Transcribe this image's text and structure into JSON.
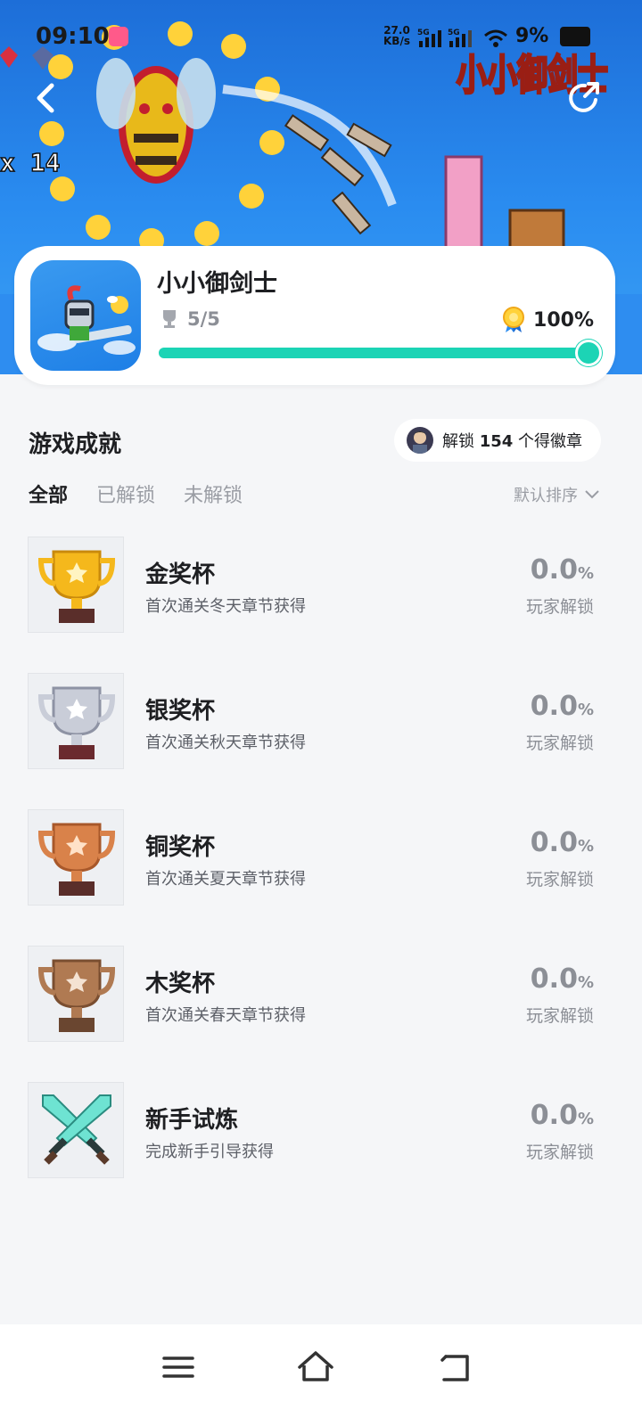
{
  "status_bar": {
    "time": "09:10",
    "net_speed": "27.0",
    "net_unit": "KB/s",
    "signal_1": "5G",
    "signal_2": "5G",
    "battery": "9%"
  },
  "hero": {
    "logo_text": "小小御剑士",
    "score_text": "x 14"
  },
  "game": {
    "title": "小小御剑士",
    "trophies": "5/5",
    "completion": "100%",
    "progress": 1.0
  },
  "achievements_section": {
    "title": "游戏成就",
    "badge_prefix": "解锁",
    "badge_count": "154",
    "badge_suffix": "个得徽章"
  },
  "filters": {
    "tabs": [
      "全部",
      "已解锁",
      "未解锁"
    ],
    "active_index": 0,
    "sort_label": "默认排序"
  },
  "achievements": [
    {
      "name": "金奖杯",
      "desc": "首次通关冬天章节获得",
      "rate": "0.0",
      "unit": "%",
      "label": "玩家解锁",
      "icon": "gold-trophy-icon"
    },
    {
      "name": "银奖杯",
      "desc": "首次通关秋天章节获得",
      "rate": "0.0",
      "unit": "%",
      "label": "玩家解锁",
      "icon": "silver-trophy-icon"
    },
    {
      "name": "铜奖杯",
      "desc": "首次通关夏天章节获得",
      "rate": "0.0",
      "unit": "%",
      "label": "玩家解锁",
      "icon": "bronze-trophy-icon"
    },
    {
      "name": "木奖杯",
      "desc": "首次通关春天章节获得",
      "rate": "0.0",
      "unit": "%",
      "label": "玩家解锁",
      "icon": "wood-trophy-icon"
    },
    {
      "name": "新手试炼",
      "desc": "完成新手引导获得",
      "rate": "0.0",
      "unit": "%",
      "label": "玩家解锁",
      "icon": "crossed-swords-icon"
    }
  ],
  "colors": {
    "accent": "#1cd4b5",
    "gold": "#f5b81c",
    "silver": "#c9cdd8",
    "bronze": "#d9824a",
    "wood": "#b07a52",
    "sword": "#6ee3d2"
  },
  "nav": {
    "icons": [
      "menu-icon",
      "home-icon",
      "back-icon"
    ]
  }
}
